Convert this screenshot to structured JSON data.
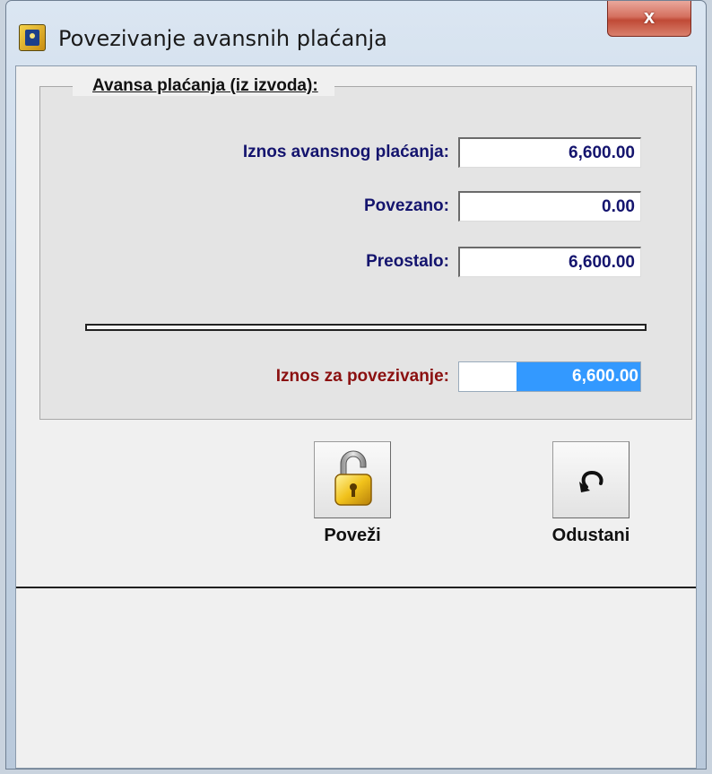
{
  "window": {
    "title": "Povezivanje avansnih plaćanja",
    "close_label": "x"
  },
  "group": {
    "title": "Avansa plaćanja (iz izvoda):",
    "fields": [
      {
        "label": "Iznos avansnog plaćanja:",
        "value": "6,600.00"
      },
      {
        "label": "Povezano:",
        "value": "0.00"
      },
      {
        "label": "Preostalo:",
        "value": "6,600.00"
      }
    ],
    "link_amount": {
      "label": "Iznos za povezivanje:",
      "value": "6,600.00"
    }
  },
  "buttons": {
    "link": {
      "label": "Poveži",
      "icon": "padlock-icon"
    },
    "cancel": {
      "label": "Odustani",
      "icon": "undo-arrow-icon"
    }
  },
  "colors": {
    "label_blue": "#14146e",
    "label_red": "#8b1010",
    "selection": "#3399ff"
  }
}
